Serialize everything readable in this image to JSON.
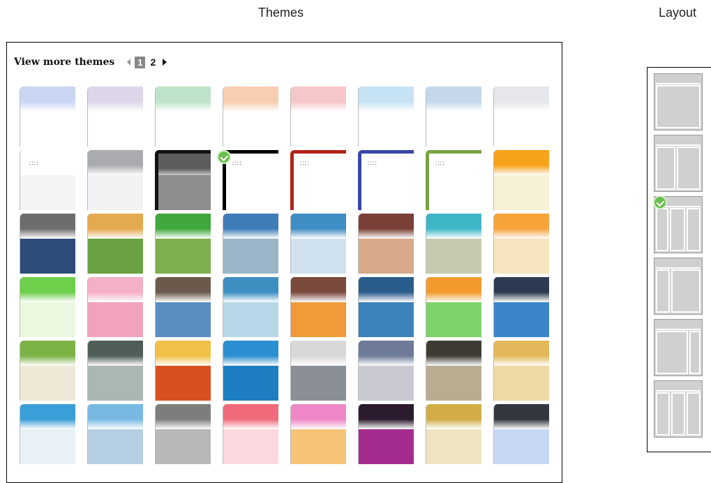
{
  "headings": {
    "themes": "Themes",
    "layout": "Layout"
  },
  "pager": {
    "view_more": "View more themes",
    "pages": [
      "1",
      "2"
    ],
    "current_page": "1"
  },
  "themes": [
    {
      "name": "lavender-blue",
      "hdr": "#c9d6f3",
      "body": "#ffffff"
    },
    {
      "name": "lilac",
      "hdr": "#ddd6ea",
      "body": "#ffffff"
    },
    {
      "name": "mint",
      "hdr": "#bfe3c9",
      "body": "#ffffff"
    },
    {
      "name": "peach",
      "hdr": "#f8cdb0",
      "body": "#ffffff"
    },
    {
      "name": "rose",
      "hdr": "#f6c7c9",
      "body": "#ffffff"
    },
    {
      "name": "sky",
      "hdr": "#c6e3f6",
      "body": "#ffffff"
    },
    {
      "name": "steel-blue",
      "hdr": "#c4d8ea",
      "body": "#ffffff"
    },
    {
      "name": "silver",
      "hdr": "#e5e7ec",
      "body": "#ffffff"
    },
    {
      "name": "plain-white",
      "hdr": "#ffffff",
      "body": "#f4f4f6",
      "dots": true
    },
    {
      "name": "grey",
      "hdr": "#a9abb0",
      "body": "#f2f2f4"
    },
    {
      "name": "black-frame",
      "hdr": "#5d5d5d",
      "body": "#8d8d8d"
    },
    {
      "name": "black-edge",
      "hdr": "#ffffff",
      "body": "#ffffff",
      "dots": true,
      "selected": true
    },
    {
      "name": "red-edge",
      "hdr": "#ffffff",
      "body": "#ffffff",
      "dots": true
    },
    {
      "name": "blue-edge",
      "hdr": "#ffffff",
      "body": "#ffffff",
      "dots": true
    },
    {
      "name": "green-edge",
      "hdr": "#ffffff",
      "body": "#ffffff",
      "dots": true
    },
    {
      "name": "orange-cartoon",
      "hdr": "#f7a21b",
      "body": "#f7f1d6"
    },
    {
      "name": "comic",
      "hdr": "#6d6d6d",
      "body": "#2e4d7a"
    },
    {
      "name": "grass-bird",
      "hdr": "#e5a94e",
      "body": "#6aa142"
    },
    {
      "name": "soccer",
      "hdr": "#3fa73b",
      "body": "#7fae4e"
    },
    {
      "name": "cyclist",
      "hdr": "#3e7cb7",
      "body": "#9cb6c9"
    },
    {
      "name": "snowboard",
      "hdr": "#3e8dc4",
      "body": "#cfe1ee"
    },
    {
      "name": "desert-trees",
      "hdr": "#7a3f36",
      "body": "#d8a98b"
    },
    {
      "name": "mosaic",
      "hdr": "#3fb6c6",
      "body": "#c6cbb0"
    },
    {
      "name": "anime-orange",
      "hdr": "#f6a33a",
      "body": "#f7e3bd"
    },
    {
      "name": "strawberry",
      "hdr": "#6dcf4a",
      "body": "#eaf8df"
    },
    {
      "name": "pink-stars",
      "hdr": "#f4b0c7",
      "body": "#f3a2bd"
    },
    {
      "name": "mountains",
      "hdr": "#6b5a4b",
      "body": "#5a8ec2"
    },
    {
      "name": "city-tower",
      "hdr": "#3d8fc1",
      "body": "#b7d7e8"
    },
    {
      "name": "pagoda",
      "hdr": "#7a4a3c",
      "body": "#f09a3a"
    },
    {
      "name": "night-city",
      "hdr": "#2a5c8c",
      "body": "#3d83bd"
    },
    {
      "name": "green-field",
      "hdr": "#f29b2c",
      "body": "#7fd16a"
    },
    {
      "name": "clouds",
      "hdr": "#2c3b52",
      "body": "#3b86c9"
    },
    {
      "name": "teapot",
      "hdr": "#7bb346",
      "body": "#efe8d6"
    },
    {
      "name": "starfish",
      "hdr": "#4f5e57",
      "body": "#aab8b4"
    },
    {
      "name": "coral",
      "hdr": "#f1c046",
      "body": "#d8501f"
    },
    {
      "name": "fish",
      "hdr": "#2a8ed0",
      "body": "#1d7ec2"
    },
    {
      "name": "cats",
      "hdr": "#d8d8d8",
      "body": "#8a8f96"
    },
    {
      "name": "puppies-blue",
      "hdr": "#6d7a98",
      "body": "#c9c9d3"
    },
    {
      "name": "bulldog",
      "hdr": "#3e3b33",
      "body": "#b9ad91"
    },
    {
      "name": "golden-puppies",
      "hdr": "#e2b85a",
      "body": "#efd9a4"
    },
    {
      "name": "graffiti",
      "hdr": "#3a9fd8",
      "body": "#e8f1f6"
    },
    {
      "name": "blue-arrows",
      "hdr": "#78b9e3",
      "body": "#b7cfe2"
    },
    {
      "name": "grey-arrows",
      "hdr": "#7d7d7d",
      "body": "#b8b8b8"
    },
    {
      "name": "hearts",
      "hdr": "#f06a7b",
      "body": "#fbd8dd"
    },
    {
      "name": "pink-petals",
      "hdr": "#ee87c6",
      "body": "#f6c478"
    },
    {
      "name": "purple-gold",
      "hdr": "#2c1a2e",
      "body": "#a42c8e"
    },
    {
      "name": "gold-pattern",
      "hdr": "#d2ad47",
      "body": "#efe4bf"
    },
    {
      "name": "blue-circles",
      "hdr": "#33363d",
      "body": "#c7d8f6"
    }
  ],
  "layouts": [
    {
      "name": "single-column",
      "panes": [
        [
          2,
          16,
          64,
          62
        ]
      ]
    },
    {
      "name": "two-column-left",
      "panes": [
        [
          2,
          16,
          28,
          62
        ],
        [
          32,
          16,
          34,
          62
        ]
      ]
    },
    {
      "name": "wide-left-narrow-right",
      "selected": true,
      "panes": [
        [
          2,
          16,
          18,
          62
        ],
        [
          22,
          16,
          22,
          62
        ],
        [
          46,
          16,
          20,
          62
        ]
      ]
    },
    {
      "name": "narrow-left-wide-right",
      "panes": [
        [
          2,
          16,
          20,
          62
        ],
        [
          24,
          16,
          42,
          62
        ]
      ]
    },
    {
      "name": "wide-left-two-narrow",
      "panes": [
        [
          2,
          16,
          46,
          62
        ],
        [
          50,
          16,
          16,
          62
        ]
      ]
    },
    {
      "name": "three-equal-columns",
      "panes": [
        [
          2,
          16,
          20,
          62
        ],
        [
          24,
          16,
          20,
          62
        ],
        [
          46,
          16,
          20,
          62
        ]
      ]
    }
  ]
}
